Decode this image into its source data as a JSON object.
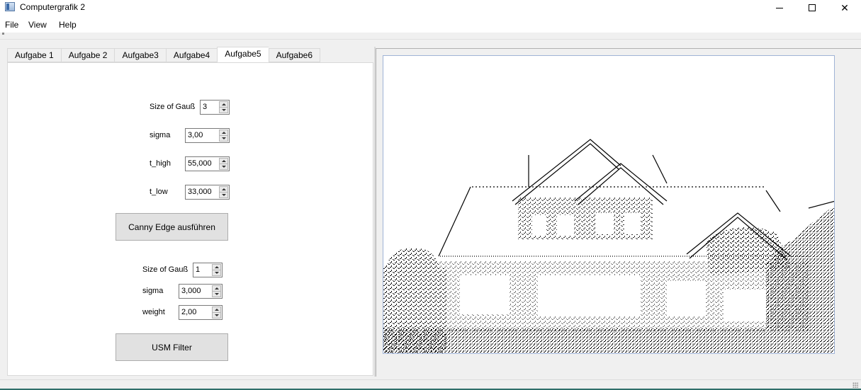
{
  "window": {
    "title": "Computergrafik 2",
    "minimize_glyph": "minimize-icon",
    "maximize_glyph": "maximize-icon",
    "close_glyph": "✕"
  },
  "menu": {
    "items": [
      "File",
      "View",
      "Help"
    ]
  },
  "tabs": {
    "items": [
      "Aufgabe 1",
      "Aufgabe 2",
      "Aufgabe3",
      "Aufgabe4",
      "Aufgabe5",
      "Aufgabe6"
    ],
    "active": "Aufgabe5"
  },
  "canny": {
    "gauss_label": "Size of Gauß",
    "gauss_value": "3",
    "sigma_label": "sigma",
    "sigma_value": "3,00",
    "thigh_label": "t_high",
    "thigh_value": "55,000",
    "tlow_label": "t_low",
    "tlow_value": "33,000",
    "button_label": "Canny Edge ausführen"
  },
  "usm": {
    "gauss_label": "Size of Gauß",
    "gauss_value": "1",
    "sigma_label": "sigma",
    "sigma_value": "3,000",
    "weight_label": "weight",
    "weight_value": "2,00",
    "button_label": "USM Filter"
  },
  "colors": {
    "accent_bottom": "#2f6f6a",
    "canvas_border": "#9fb3d6"
  }
}
